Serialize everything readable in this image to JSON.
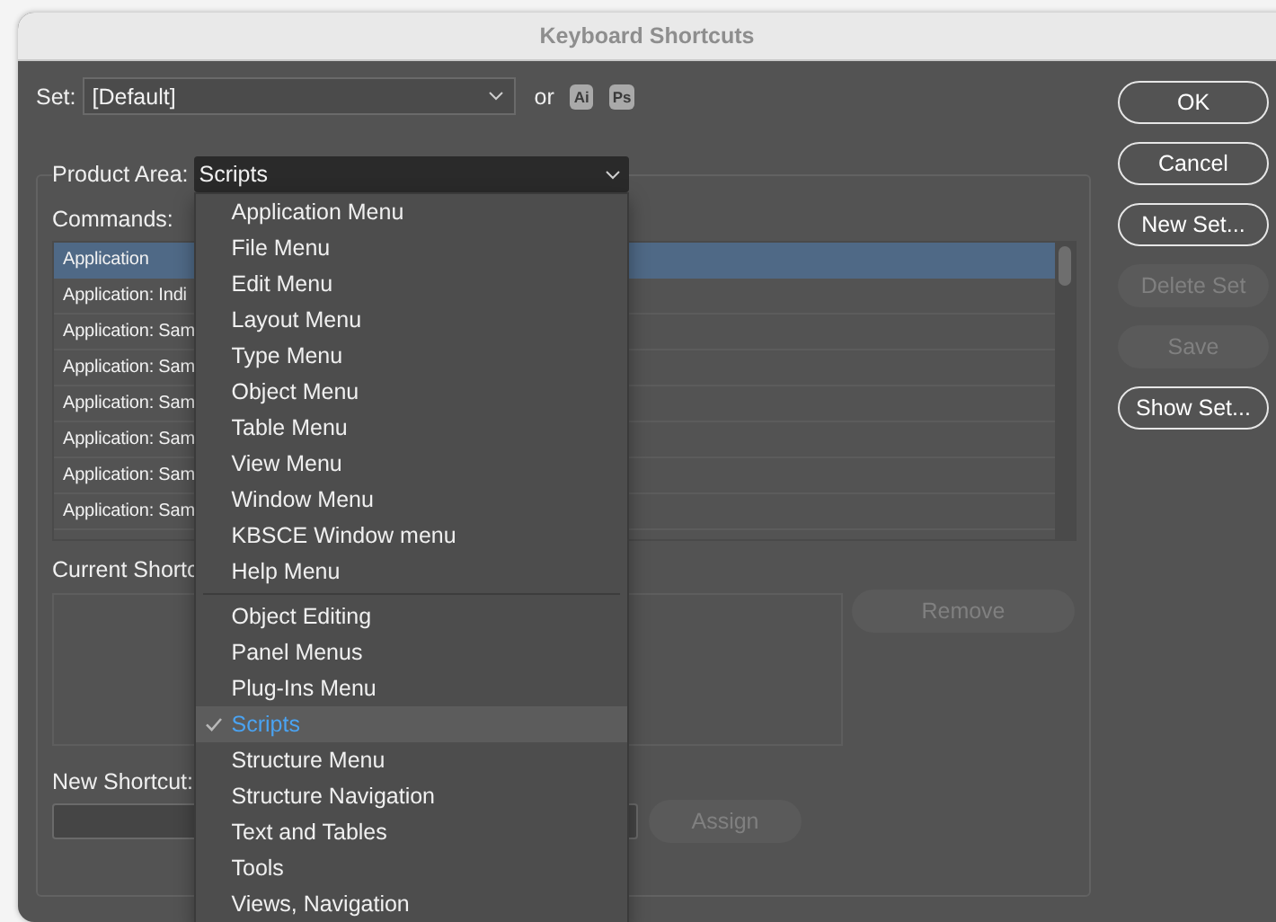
{
  "window": {
    "title": "Keyboard Shortcuts"
  },
  "set": {
    "label": "Set:",
    "value": "[Default]",
    "or": "or",
    "app_badges": [
      "Ai",
      "Ps"
    ]
  },
  "product_area": {
    "label": "Product Area:",
    "value": "Scripts",
    "expanded": true,
    "menu_groups": [
      [
        {
          "label": "Application Menu",
          "selected": false
        },
        {
          "label": "File Menu",
          "selected": false
        },
        {
          "label": "Edit Menu",
          "selected": false
        },
        {
          "label": "Layout Menu",
          "selected": false
        },
        {
          "label": "Type Menu",
          "selected": false
        },
        {
          "label": "Object Menu",
          "selected": false
        },
        {
          "label": "Table Menu",
          "selected": false
        },
        {
          "label": "View Menu",
          "selected": false
        },
        {
          "label": "Window Menu",
          "selected": false
        },
        {
          "label": "KBSCE Window menu",
          "selected": false
        },
        {
          "label": "Help Menu",
          "selected": false
        }
      ],
      [
        {
          "label": "Object Editing",
          "selected": false
        },
        {
          "label": "Panel Menus",
          "selected": false
        },
        {
          "label": "Plug-Ins Menu",
          "selected": false
        },
        {
          "label": "Scripts",
          "selected": true
        },
        {
          "label": "Structure Menu",
          "selected": false
        },
        {
          "label": "Structure Navigation",
          "selected": false
        },
        {
          "label": "Text and Tables",
          "selected": false
        },
        {
          "label": "Tools",
          "selected": false
        },
        {
          "label": "Views, Navigation",
          "selected": false
        }
      ]
    ]
  },
  "commands": {
    "label": "Commands:",
    "rows": [
      {
        "text": "Application",
        "selected": true
      },
      {
        "text": "Application: Indi",
        "selected": false
      },
      {
        "text": "Application: Sam",
        "selected": false
      },
      {
        "text": "Application: Sam",
        "selected": false
      },
      {
        "text": "Application: Sam",
        "selected": false
      },
      {
        "text": "Application: Sam",
        "selected": false
      },
      {
        "text": "Application: Sam",
        "selected": false
      },
      {
        "text": "Application: Sam",
        "selected": false
      }
    ]
  },
  "current_shortcuts": {
    "label": "Current Shortc"
  },
  "remove_button": {
    "label": "Remove",
    "disabled": true
  },
  "new_shortcut": {
    "label": "New Shortcut:"
  },
  "assign_button": {
    "label": "Assign",
    "disabled": true
  },
  "buttons": [
    {
      "label": "OK",
      "disabled": false
    },
    {
      "label": "Cancel",
      "disabled": false
    },
    {
      "label": "New Set...",
      "disabled": false
    },
    {
      "label": "Delete Set",
      "disabled": true
    },
    {
      "label": "Save",
      "disabled": true
    },
    {
      "label": "Show Set...",
      "disabled": false
    }
  ]
}
